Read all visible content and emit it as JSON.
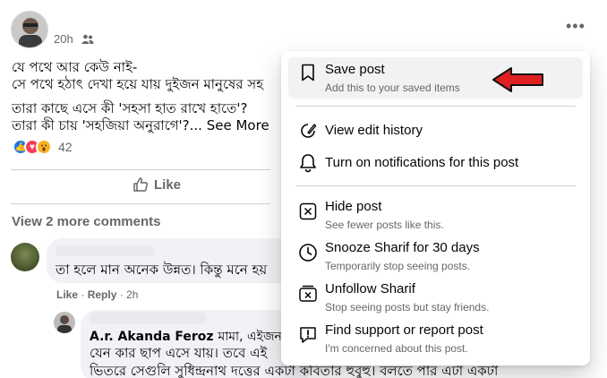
{
  "post": {
    "time": "20h",
    "text_lines": [
      "যে পথে আর কেউ নাই-",
      "সে পথে হঠাৎ দেখা হয়ে যায় দুইজন মানুষের সহ"
    ],
    "text_lines_2": [
      "তারা কাছে এসে কী 'সহসা হাত রাখে হাতে'?",
      "তারা কী চায় 'সহজিয়া অনুরাগে'?..."
    ],
    "see_more": "See More",
    "reaction_count": "42",
    "like_label": "Like"
  },
  "comments": {
    "view_more": "View 2 more comments",
    "comment1": {
      "text": "তা হলে মান অনেক উন্নত। কিন্তু মনে হয়",
      "like": "Like",
      "reply": "Reply",
      "time": "2h",
      "sep": "·"
    },
    "reply1": {
      "name": "A.r. Akanda Feroz",
      "name_suffix": "মামা, এইজনাই",
      "lines": [
        "যেন কার ছাপ এসে যায়। তবে এই",
        "ভিতরে সেগুলি সুধিন্দ্রনাথ দত্তের একটা কবিতার হুবুহু। বলতে পার এটা একটা"
      ]
    }
  },
  "menu": {
    "items": [
      {
        "title": "Save post",
        "subtitle": "Add this to your saved items"
      },
      {
        "title": "View edit history",
        "subtitle": ""
      },
      {
        "title": "Turn on notifications for this post",
        "subtitle": ""
      },
      {
        "title": "Hide post",
        "subtitle": "See fewer posts like this."
      },
      {
        "title": "Snooze Sharif for 30 days",
        "subtitle": "Temporarily stop seeing posts."
      },
      {
        "title": "Unfollow Sharif",
        "subtitle": "Stop seeing posts but stay friends."
      },
      {
        "title": "Find support or report post",
        "subtitle": "I'm concerned about this post."
      }
    ]
  },
  "colors": {
    "secondary_text": "#65676b",
    "arrow": "#e02020",
    "like_blue": "#1877f2"
  }
}
